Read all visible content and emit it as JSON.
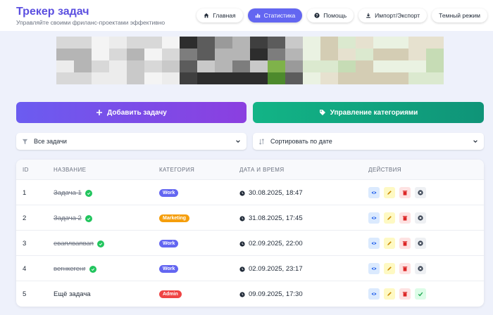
{
  "header": {
    "title": "Трекер задач",
    "subtitle": "Управляйте своими фриланс-проектами эффективно",
    "nav": [
      {
        "label": "Главная",
        "icon": "home-icon",
        "active": false
      },
      {
        "label": "Статистика",
        "icon": "bar-chart-icon",
        "active": true
      },
      {
        "label": "Помощь",
        "icon": "help-icon",
        "active": false
      },
      {
        "label": "Импорт/Экспорт",
        "icon": "download-icon",
        "active": false
      },
      {
        "label": "Темный режим",
        "icon": "",
        "active": false
      }
    ]
  },
  "actions": {
    "add_task": "Добавить задачу",
    "manage_categories": "Управление категориями"
  },
  "filters": {
    "filter_value": "Все задачи",
    "sort_value": "Сортировать по дате"
  },
  "table": {
    "columns": [
      "ID",
      "НАЗВАНИЕ",
      "КАТЕГОРИЯ",
      "ДАТА И ВРЕМЯ",
      "ДЕЙСТВИЯ"
    ],
    "rows": [
      {
        "id": "1",
        "name": "Задача 1",
        "done": true,
        "category": "Work",
        "date": "30.08.2025, 18:47"
      },
      {
        "id": "2",
        "name": "Задача 2",
        "done": true,
        "category": "Marketing",
        "date": "31.08.2025, 17:45"
      },
      {
        "id": "3",
        "name": "еваплвапвап",
        "done": true,
        "category": "Work",
        "date": "02.09.2025, 22:00"
      },
      {
        "id": "4",
        "name": "вегнкегенг",
        "done": true,
        "category": "Work",
        "date": "02.09.2025, 23:17"
      },
      {
        "id": "5",
        "name": "Ещё задача",
        "done": false,
        "category": "Admin",
        "date": "09.09.2025, 17:30"
      }
    ]
  },
  "colors": {
    "accent": "#6366f1",
    "Work": "#6366f1",
    "Marketing": "#f59e0b",
    "Admin": "#ef4444",
    "success": "#22c55e"
  }
}
